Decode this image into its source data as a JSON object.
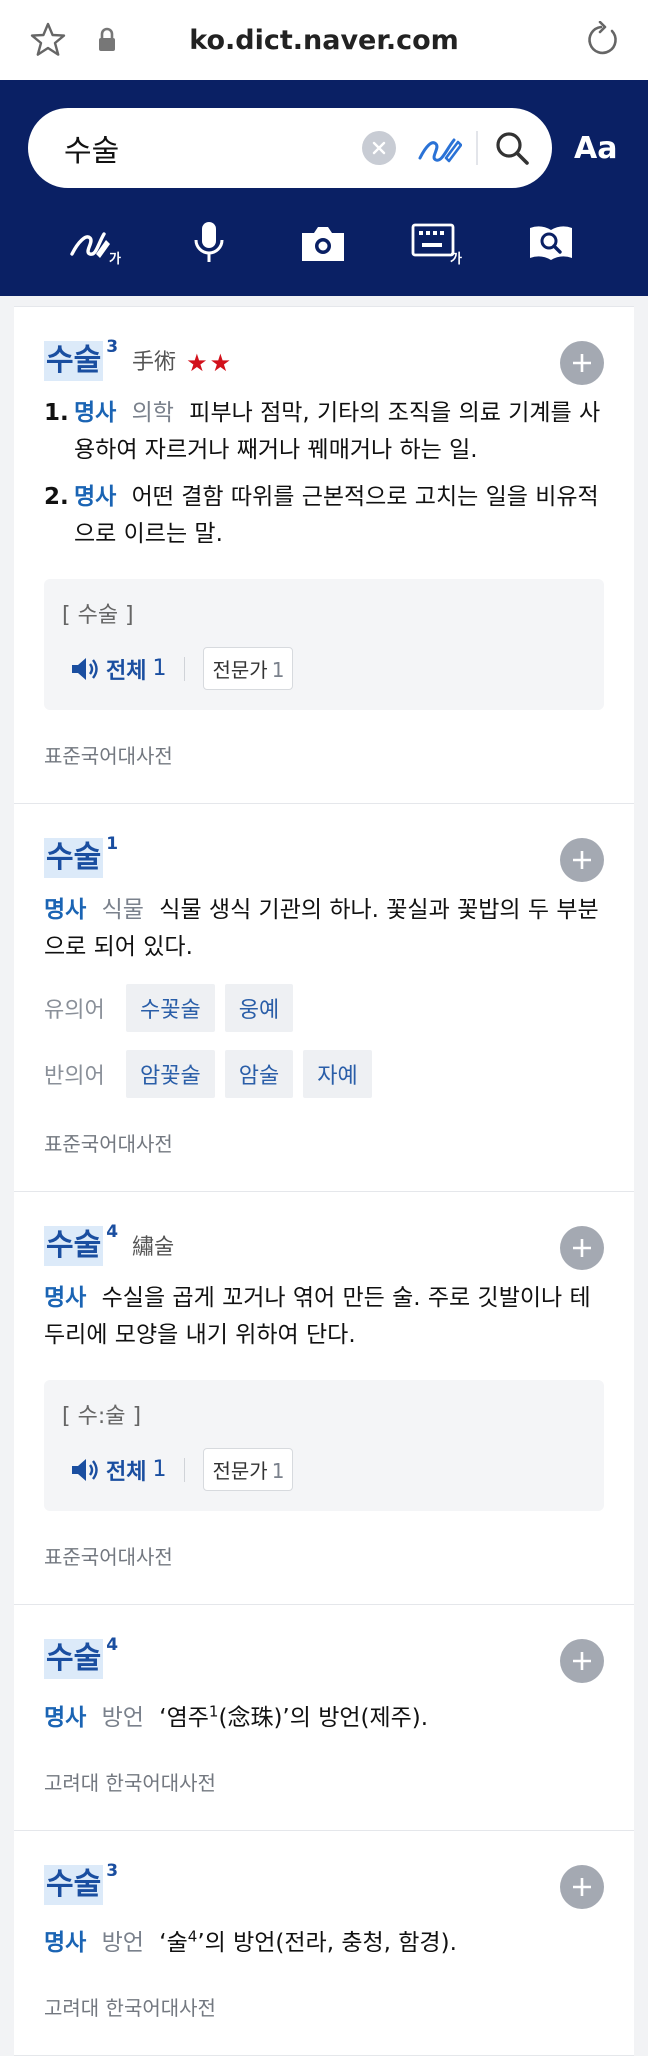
{
  "browser": {
    "url": "ko.dict.naver.com"
  },
  "search": {
    "query": "수술",
    "font_button": "Aa"
  },
  "toolbar": [
    "handwriting-icon",
    "microphone-icon",
    "camera-icon",
    "keyboard-icon",
    "book-search-icon"
  ],
  "entries": [
    {
      "headword": "수술",
      "sup": "3",
      "hanja": "手術",
      "stars": "★★",
      "defs": [
        {
          "num": "1.",
          "pos": "명사",
          "field": "의학",
          "text": "피부나 점막, 기타의 조직을 의료 기계를 사용하여 자르거나 째거나 꿰매거나 하는 일."
        },
        {
          "num": "2.",
          "pos": "명사",
          "text": "어떤 결함 따위를 근본적으로 고치는 일을 비유적으로 이르는 말."
        }
      ],
      "pronunciation": "[ 수술 ]",
      "audio_all": "전체",
      "audio_all_count": "1",
      "expert": "전문가",
      "expert_count": "1",
      "source": "표준국어대사전"
    },
    {
      "headword": "수술",
      "sup": "1",
      "pos": "명사",
      "field": "식물",
      "text": "식물 생식 기관의 하나. 꽃실과 꽃밥의 두 부분으로 되어 있다.",
      "synonym_label": "유의어",
      "synonyms": [
        "수꽃술",
        "웅예"
      ],
      "antonym_label": "반의어",
      "antonyms": [
        "암꽃술",
        "암술",
        "자예"
      ],
      "source": "표준국어대사전"
    },
    {
      "headword": "수술",
      "sup": "4",
      "hanja": "繡술",
      "pos": "명사",
      "text": "수실을 곱게 꼬거나 엮어 만든 술. 주로 깃발이나 테두리에 모양을 내기 위하여 단다.",
      "pronunciation": "[ 수:술 ]",
      "audio_all": "전체",
      "audio_all_count": "1",
      "expert": "전문가",
      "expert_count": "1",
      "source": "표준국어대사전"
    },
    {
      "headword": "수술",
      "sup": "4",
      "pos": "명사",
      "field": "방언",
      "text_before": "‘염주",
      "text_sup": "1",
      "text_after": "(念珠)’의 방언(제주).",
      "source": "고려대 한국어대사전"
    },
    {
      "headword": "수술",
      "sup": "3",
      "pos": "명사",
      "field": "방언",
      "text_before": "‘술",
      "text_sup": "4",
      "text_after": "’의 방언(전라, 충청, 함경).",
      "source": "고려대 한국어대사전"
    }
  ]
}
